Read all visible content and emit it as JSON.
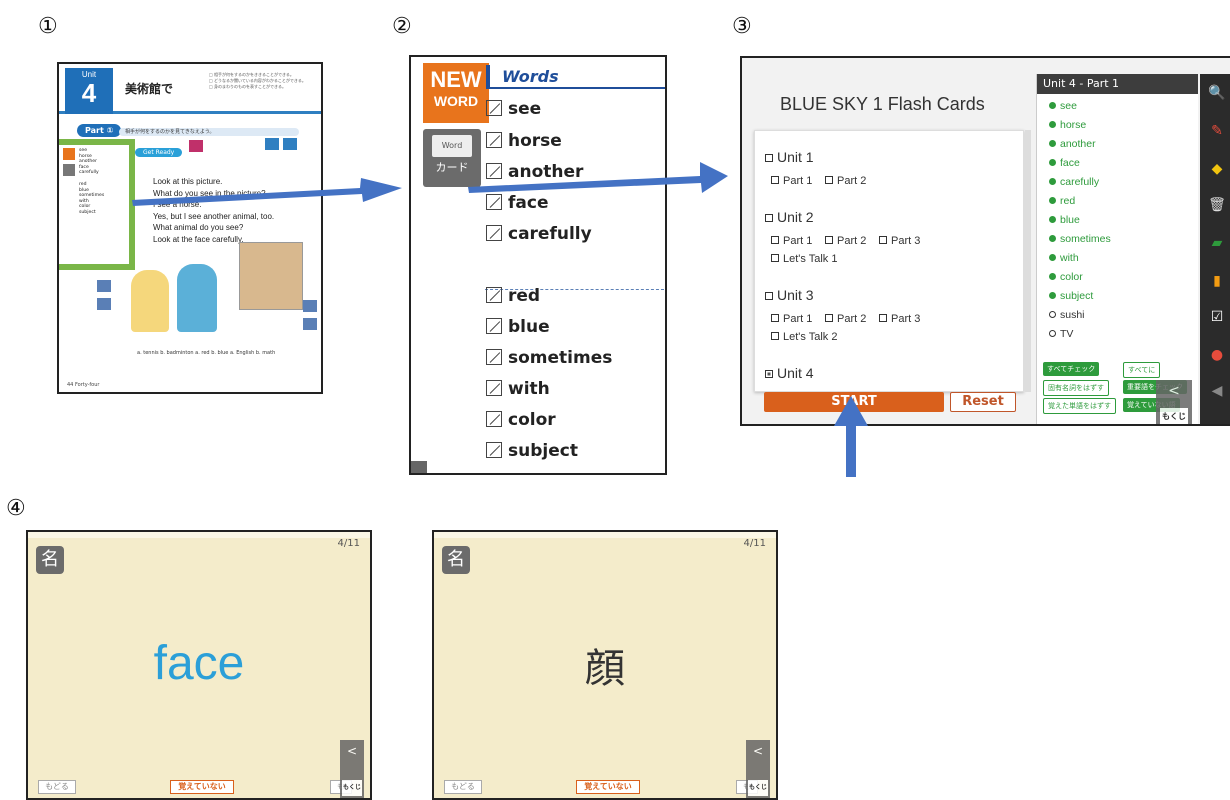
{
  "steps": [
    "①",
    "②",
    "③",
    "④"
  ],
  "panel1": {
    "unit_label": "Unit",
    "unit_number": "4",
    "title": "美術館で",
    "goals": [
      "□ 相手が何をするのかをききることができる。",
      "□ どうなるか聞いている内容がわかることができる。",
      "□ 身のまわりのものを表すことができる。"
    ],
    "part_label": "Part ①",
    "part_goal": "相手が何をするのかを見てきなえよう。",
    "get_ready": "Get Ready",
    "lines": [
      "Look at this picture.",
      "What do you see in the picture?",
      "I see a horse.",
      "Yes, but I see another animal, too.",
      "What animal do you see?",
      "Look at the face carefully."
    ],
    "words": [
      "see",
      "horse",
      "another",
      "face",
      "carefully",
      "",
      "red",
      "blue",
      "sometimes",
      "with",
      "color",
      "subject"
    ],
    "bottom_row": "a. tennis  b. badminton     a. red  b. blue     a. English  b. math",
    "footer": "44 Forty-four"
  },
  "panel2": {
    "new": "NEW",
    "word": "WORD",
    "card_small": "Word",
    "card_label": "カード",
    "header": "Words",
    "words_top": [
      "see",
      "horse",
      "another",
      "face",
      "carefully"
    ],
    "words_bottom": [
      "red",
      "blue",
      "sometimes",
      "with",
      "color",
      "subject"
    ]
  },
  "panel3": {
    "title": "BLUE SKY 1 Flash Cards",
    "units": [
      {
        "name": "Unit 1",
        "parts": [
          "Part 1",
          "Part 2"
        ],
        "talk": ""
      },
      {
        "name": "Unit 2",
        "parts": [
          "Part 1",
          "Part 2",
          "Part 3"
        ],
        "talk": "Let's Talk 1"
      },
      {
        "name": "Unit 3",
        "parts": [
          "Part 1",
          "Part 2",
          "Part 3"
        ],
        "talk": "Let's Talk 2"
      },
      {
        "name": "Unit 4",
        "parts": [],
        "talk": ""
      }
    ],
    "start": "START",
    "reset": "Reset",
    "side_header": "Unit 4 - Part 1",
    "side_words": [
      {
        "w": "see",
        "on": true
      },
      {
        "w": "horse",
        "on": true
      },
      {
        "w": "another",
        "on": true
      },
      {
        "w": "face",
        "on": true
      },
      {
        "w": "carefully",
        "on": true
      },
      {
        "w": "red",
        "on": true
      },
      {
        "w": "blue",
        "on": true
      },
      {
        "w": "sometimes",
        "on": true
      },
      {
        "w": "with",
        "on": true
      },
      {
        "w": "color",
        "on": true
      },
      {
        "w": "subject",
        "on": true
      },
      {
        "w": "sushi",
        "on": false
      },
      {
        "w": "TV",
        "on": false
      }
    ],
    "buttons": [
      "すべてチェック",
      "すべてに",
      "固有名詞をはずす",
      "重要語をチェック",
      "覚えた単語をはずす",
      "覚えていない語"
    ],
    "nav_arrow": "<",
    "nav_menu": "もくじ"
  },
  "panel4": {
    "pos": "名",
    "counter": "4/11",
    "front": "face",
    "back_text": "顔",
    "btn_back": "もどる",
    "btn_notyet": "覚えていない",
    "btn_fwd": "も",
    "nav_arrow": "<",
    "nav_menu": "もくじ"
  },
  "colors": {
    "accent_blue": "#4472c4",
    "start_orange": "#d9601c",
    "green": "#2e9b3c",
    "card_bg": "#f4eccb"
  }
}
